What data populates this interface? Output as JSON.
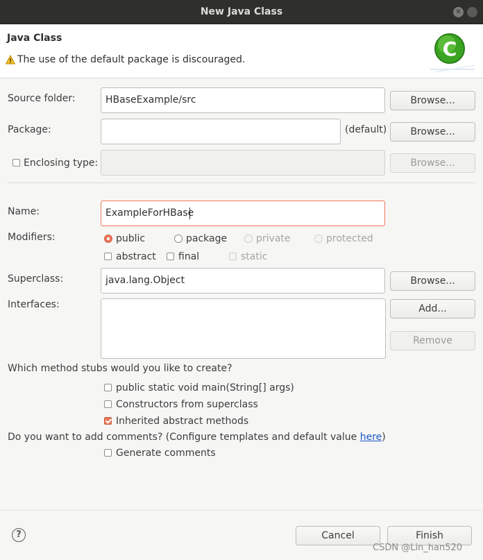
{
  "window": {
    "title": "New Java Class"
  },
  "header": {
    "title": "Java Class",
    "message": "The use of the default package is discouraged.",
    "logo_letter": "C"
  },
  "form": {
    "source_folder": {
      "label": "Source folder:",
      "value": "HBaseExample/src",
      "button": "Browse..."
    },
    "package": {
      "label": "Package:",
      "value": "",
      "suffix": "(default)",
      "button": "Browse..."
    },
    "enclosing_type": {
      "label": "Enclosing type:",
      "value": "",
      "button": "Browse...",
      "checked": false
    },
    "name": {
      "label": "Name:",
      "value": "ExampleForHBase"
    },
    "modifiers": {
      "label": "Modifiers:",
      "radios": [
        "public",
        "package",
        "private",
        "protected"
      ],
      "selected": "public",
      "checkboxes": [
        "abstract",
        "final",
        "static"
      ]
    },
    "superclass": {
      "label": "Superclass:",
      "value": "java.lang.Object",
      "button": "Browse..."
    },
    "interfaces": {
      "label": "Interfaces:",
      "add_button": "Add...",
      "remove_button": "Remove"
    },
    "stubs": {
      "question": "Which method stubs would you like to create?",
      "options": [
        "public static void main(String[] args)",
        "Constructors from superclass",
        "Inherited abstract methods"
      ],
      "checked": [
        false,
        false,
        true
      ]
    },
    "comments": {
      "question": "Do you want to add comments? (Configure templates and default value ",
      "link": "here",
      "close": ")",
      "option": "Generate comments",
      "checked": false
    }
  },
  "footer": {
    "help": "?",
    "cancel": "Cancel",
    "finish": "Finish"
  },
  "watermark": "CSDN @Lin_han520",
  "colors": {
    "accent": "#e9795a",
    "titlebar": "#2f2f2c",
    "link": "#1a56c6"
  }
}
